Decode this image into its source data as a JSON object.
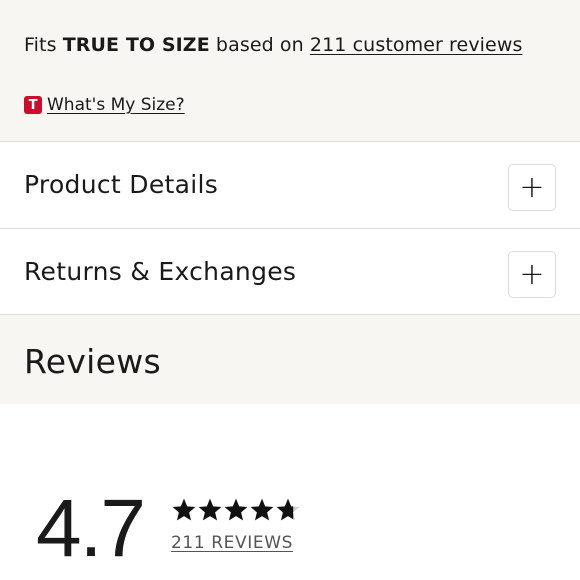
{
  "fit": {
    "prefix": "Fits",
    "fit_label": "TRUE TO SIZE",
    "middle": "based on",
    "reviews_link": "211 customer reviews",
    "size_logo_letter": "T",
    "size_link": "What's My Size?"
  },
  "accordion": {
    "product_details": "Product Details",
    "returns": "Returns & Exchanges",
    "expand_symbol": "+"
  },
  "reviews": {
    "title": "Reviews",
    "rating": "4.7",
    "stars_value": 4.7,
    "stars_max": 5,
    "count_link": "211 REVIEWS"
  },
  "colors": {
    "brand_red": "#c8102e",
    "panel_bg": "#f8f6f3"
  },
  "icons": {
    "star": "star-icon",
    "plus": "plus-icon",
    "logo": "t-logo-icon"
  }
}
